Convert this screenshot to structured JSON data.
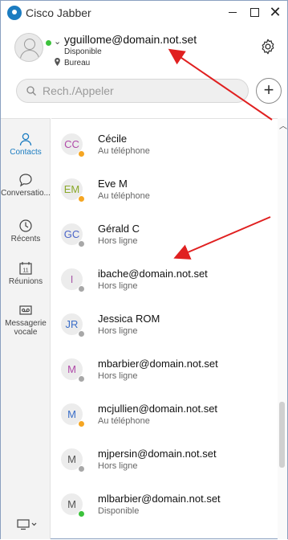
{
  "app": {
    "title": "Cisco Jabber"
  },
  "user": {
    "email": "yguillome@domain.not.set",
    "status": "Disponible",
    "location": "Bureau"
  },
  "search": {
    "placeholder": "Rech./Appeler"
  },
  "nav": [
    {
      "label": "Contacts",
      "icon": "person-icon",
      "active": true
    },
    {
      "label": "Conversatio...",
      "icon": "chat-bubble-icon"
    },
    {
      "label": "Récents",
      "icon": "clock-icon"
    },
    {
      "label": "Réunions",
      "icon": "calendar-icon",
      "badge": "11"
    },
    {
      "label": "Messagerie vocale",
      "icon": "voicemail-icon"
    }
  ],
  "contacts": [
    {
      "initials": "CC",
      "name": "Cécile",
      "status": "Au téléphone",
      "dot": "#f5a623",
      "color": "#b04aa8"
    },
    {
      "initials": "EM",
      "name": "Eve M",
      "status": "Au téléphone",
      "dot": "#f5a623",
      "color": "#8aa82a"
    },
    {
      "initials": "GC",
      "name": "Gérald C",
      "status": "Hors ligne",
      "dot": "#a8a8a8",
      "color": "#4a64c8"
    },
    {
      "initials": "I",
      "name": "ibache@domain.not.set",
      "status": "Hors ligne",
      "dot": "#a8a8a8",
      "color": "#a85aa8"
    },
    {
      "initials": "JR",
      "name": "Jessica ROM",
      "status": "Hors ligne",
      "dot": "#a8a8a8",
      "color": "#3a6ec8"
    },
    {
      "initials": "M",
      "name": "mbarbier@domain.not.set",
      "status": "Hors ligne",
      "dot": "#a8a8a8",
      "color": "#b04aa8"
    },
    {
      "initials": "M",
      "name": "mcjullien@domain.not.set",
      "status": "Au téléphone",
      "dot": "#f5a623",
      "color": "#3a6ec8"
    },
    {
      "initials": "M",
      "name": "mjpersin@domain.not.set",
      "status": "Hors ligne",
      "dot": "#a8a8a8",
      "color": "#555555"
    },
    {
      "initials": "M",
      "name": "mlbarbier@domain.not.set",
      "status": "Disponible",
      "dot": "#3cc23c",
      "color": "#555555"
    }
  ],
  "colors": {
    "accent": "#1b7cc1",
    "arrow": "#e02020"
  }
}
